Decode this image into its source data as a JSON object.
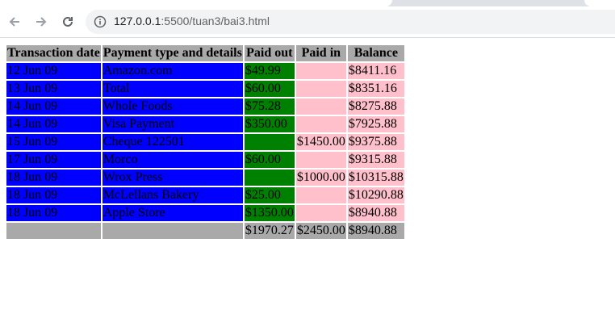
{
  "browser": {
    "url_host": "127.0.0.1",
    "url_port_path": ":5500/tuan3/bai3.html"
  },
  "table": {
    "headers": [
      "Transaction date",
      "Payment type and details",
      "Paid out",
      "Paid in",
      "Balance"
    ],
    "rows": [
      {
        "date": "12 Jun 09",
        "details": "Amazon.com",
        "paid_out": "$49.99",
        "paid_in": "",
        "balance": "$8411.16"
      },
      {
        "date": "13 Jun 09",
        "details": "Total",
        "paid_out": "$60.00",
        "paid_in": "",
        "balance": "$8351.16"
      },
      {
        "date": "14 Jun 09",
        "details": "Whole Foods",
        "paid_out": "$75.28",
        "paid_in": "",
        "balance": "$8275.88"
      },
      {
        "date": "14 Jun 09",
        "details": "Visa Payment",
        "paid_out": "$350.00",
        "paid_in": "",
        "balance": "$7925.88"
      },
      {
        "date": "15 Jun 09",
        "details": "Cheque 122501",
        "paid_out": "",
        "paid_in": "$1450.00",
        "balance": "$9375.88"
      },
      {
        "date": "17 Jun 09",
        "details": "Morco",
        "paid_out": "$60.00",
        "paid_in": "",
        "balance": "$9315.88"
      },
      {
        "date": "18 Jun 09",
        "details": "Wrox Press",
        "paid_out": "",
        "paid_in": "$1000.00",
        "balance": "$10315.88"
      },
      {
        "date": "18 Jun 09",
        "details": "McLellans Bakery",
        "paid_out": "$25.00",
        "paid_in": "",
        "balance": "$10290.88"
      },
      {
        "date": "18 Jun 09",
        "details": "Apple Store",
        "paid_out": "$1350.00",
        "paid_in": "",
        "balance": "$8940.88"
      }
    ],
    "totals": {
      "date": "",
      "details": "",
      "paid_out": "$1970.27",
      "paid_in": "$2450.00",
      "balance": "$8940.88"
    }
  },
  "colors": {
    "header_bg": "#a9a9a9",
    "date_details_bg": "#0000ff",
    "paid_out_bg": "#008000",
    "paid_in_balance_bg": "#ffc0cb"
  }
}
